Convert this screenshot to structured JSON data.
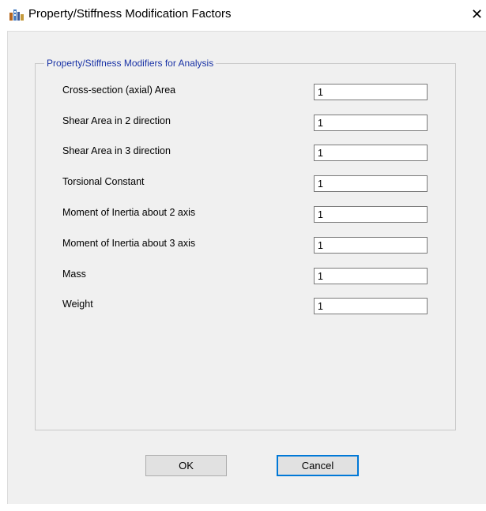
{
  "window": {
    "title": "Property/Stiffness Modification Factors",
    "app_icon": "etabs-building-icon",
    "close_glyph": "✕"
  },
  "group": {
    "title": "Property/Stiffness Modifiers for Analysis"
  },
  "rows": [
    {
      "label": "Cross-section (axial) Area",
      "value": "1"
    },
    {
      "label": "Shear Area in 2 direction",
      "value": "1"
    },
    {
      "label": "Shear Area in 3 direction",
      "value": "1"
    },
    {
      "label": "Torsional Constant",
      "value": "1"
    },
    {
      "label": "Moment of Inertia about 2 axis",
      "value": "1"
    },
    {
      "label": "Moment of Inertia about 3 axis",
      "value": "1"
    },
    {
      "label": "Mass",
      "value": "1"
    },
    {
      "label": "Weight",
      "value": "1"
    }
  ],
  "buttons": {
    "ok_label": "OK",
    "cancel_label": "Cancel"
  },
  "colors": {
    "group_title": "#1a33a6",
    "focus_border": "#0078d7",
    "dialog_bg": "#f0f0f0"
  }
}
